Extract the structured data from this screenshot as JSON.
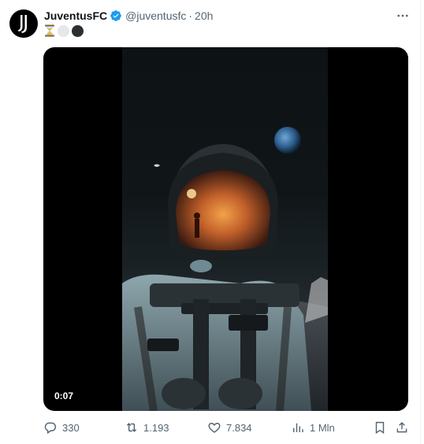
{
  "author": {
    "name": "JuventusFC",
    "handle": "@juventusfc",
    "separator": "·",
    "time": "20h"
  },
  "text": {
    "emoji": [
      "hourglass",
      "white-circle",
      "black-circle"
    ]
  },
  "media": {
    "duration": "0:07"
  },
  "actions": {
    "replies": "330",
    "reposts": "1.193",
    "likes": "7.834",
    "views": "1 Mln"
  },
  "colors": {
    "text": "#0f1419",
    "secondary": "#536471",
    "verified": "#1d9bf0"
  }
}
